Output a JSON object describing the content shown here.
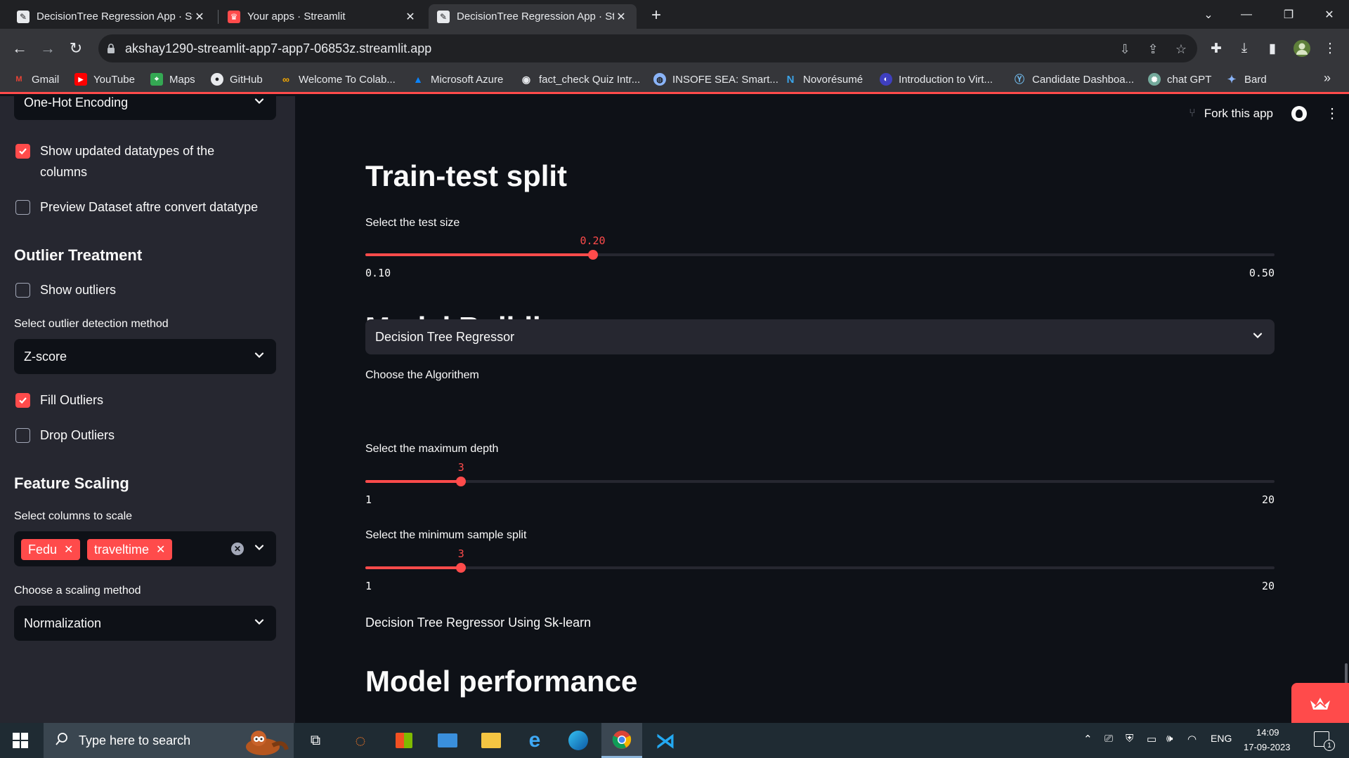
{
  "browser": {
    "tabs": [
      {
        "title": "DecisionTree Regression App · St",
        "active": false
      },
      {
        "title": "Your apps · Streamlit",
        "active": false
      },
      {
        "title": "DecisionTree Regression App · St",
        "active": true
      }
    ],
    "new_tab_symbol": "+",
    "url": "akshay1290-streamlit-app7-app7-06853z.streamlit.app",
    "bookmarks": [
      {
        "label": "Gmail",
        "icon": "gmail-icon"
      },
      {
        "label": "YouTube",
        "icon": "youtube-icon"
      },
      {
        "label": "Maps",
        "icon": "maps-icon"
      },
      {
        "label": "GitHub",
        "icon": "github-icon"
      },
      {
        "label": "Welcome To Colab...",
        "icon": "colab-icon"
      },
      {
        "label": "Microsoft Azure",
        "icon": "azure-icon"
      },
      {
        "label": "fact_check Quiz Intr...",
        "icon": "quiz-icon"
      },
      {
        "label": "INSOFE SEA: Smart...",
        "icon": "insofe-icon"
      },
      {
        "label": "Novorésumé",
        "icon": "novoresume-icon"
      },
      {
        "label": "Introduction to Virt...",
        "icon": "virt-icon"
      },
      {
        "label": "Candidate Dashboa...",
        "icon": "candidate-icon"
      },
      {
        "label": "chat GPT",
        "icon": "chatgpt-icon"
      },
      {
        "label": "Bard",
        "icon": "bard-icon"
      }
    ],
    "more_bookmarks": "»"
  },
  "sidebar": {
    "encoding_select": "One-Hot Encoding",
    "show_updated_dtypes": {
      "label_line1": "Show updated datatypes of the",
      "label_line2": "columns",
      "checked": true
    },
    "preview_dataset": {
      "label": "Preview Dataset aftre convert datatype",
      "checked": false
    },
    "outlier_heading": "Outlier Treatment",
    "show_outliers": {
      "label": "Show outliers",
      "checked": false
    },
    "outlier_method_label": "Select outlier detection method",
    "outlier_method": "Z-score",
    "fill_outliers": {
      "label": "Fill Outliers",
      "checked": true
    },
    "drop_outliers": {
      "label": "Drop Outliers",
      "checked": false
    },
    "scaling_heading": "Feature Scaling",
    "scale_columns_label": "Select columns to scale",
    "scale_columns": [
      "Fedu",
      "traveltime"
    ],
    "scaling_method_label": "Choose a scaling method",
    "scaling_method": "Normalization"
  },
  "main": {
    "fork_label": "Fork this app",
    "train_test_heading": "Train-test split",
    "test_size": {
      "label": "Select the test size",
      "value": 0.2,
      "value_text": "0.20",
      "min": 0.1,
      "min_text": "0.10",
      "max": 0.5,
      "max_text": "0.50"
    },
    "model_building_heading": "Model Building",
    "algorithm_label": "Choose the Algorithem",
    "algorithm": "Decision Tree Regressor",
    "max_depth": {
      "label": "Select the maximum depth",
      "value": 3,
      "value_text": "3",
      "min": 1,
      "min_text": "1",
      "max": 20,
      "max_text": "20"
    },
    "min_sample_split": {
      "label": "Select the minimum sample split",
      "value": 3,
      "value_text": "3",
      "min": 1,
      "min_text": "1",
      "max": 20,
      "max_text": "20"
    },
    "caption": "Decision Tree Regressor Using Sk-learn",
    "performance_heading": "Model performance"
  },
  "taskbar": {
    "search_placeholder": "Type here to search",
    "language": "ENG",
    "time": "14:09",
    "date": "17-09-2023",
    "notification_count": "1"
  },
  "colors": {
    "accent": "#ff4b4b",
    "sidebar_bg": "#262730",
    "main_bg": "#0e1117"
  }
}
